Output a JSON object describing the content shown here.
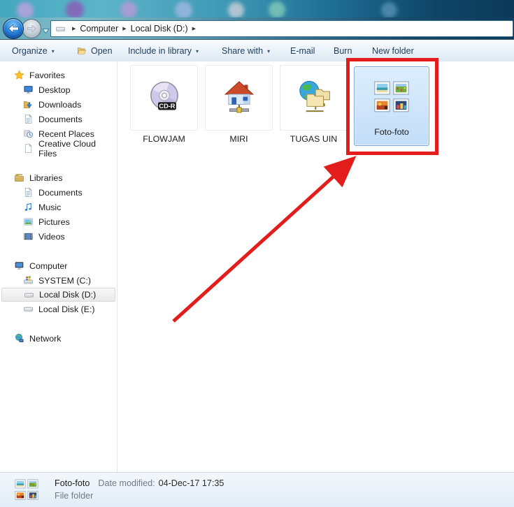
{
  "address_bar": {
    "breadcrumb": [
      "Computer",
      "Local Disk (D:)"
    ]
  },
  "toolbar": {
    "buttons": [
      {
        "label": "Organize",
        "dropdown": true
      },
      {
        "label": "Open",
        "icon": "open-folder-icon"
      },
      {
        "label": "Include in library",
        "dropdown": true
      },
      {
        "label": "Share with",
        "dropdown": true
      },
      {
        "label": "E-mail"
      },
      {
        "label": "Burn"
      },
      {
        "label": "New folder"
      }
    ]
  },
  "sidebar": {
    "sections": [
      {
        "label": "Favorites",
        "icon": "star-icon",
        "items": [
          {
            "label": "Desktop",
            "icon": "desktop-icon"
          },
          {
            "label": "Downloads",
            "icon": "downloads-icon"
          },
          {
            "label": "Documents",
            "icon": "document-icon"
          },
          {
            "label": "Recent Places",
            "icon": "recent-places-icon"
          },
          {
            "label": "Creative Cloud Files",
            "icon": "file-icon"
          }
        ]
      },
      {
        "label": "Libraries",
        "icon": "libraries-icon",
        "items": [
          {
            "label": "Documents",
            "icon": "document-icon"
          },
          {
            "label": "Music",
            "icon": "music-icon"
          },
          {
            "label": "Pictures",
            "icon": "pictures-icon"
          },
          {
            "label": "Videos",
            "icon": "videos-icon"
          }
        ]
      },
      {
        "label": "Computer",
        "icon": "computer-icon",
        "items": [
          {
            "label": "SYSTEM (C:)",
            "icon": "system-drive-icon"
          },
          {
            "label": "Local Disk (D:)",
            "icon": "drive-icon",
            "selected": true
          },
          {
            "label": "Local Disk (E:)",
            "icon": "drive-icon"
          }
        ]
      },
      {
        "label": "Network",
        "icon": "network-icon",
        "items": []
      }
    ]
  },
  "files": {
    "items": [
      {
        "label": "FLOWJAM",
        "icon": "cd-r-icon"
      },
      {
        "label": "MIRI",
        "icon": "network-home-icon"
      },
      {
        "label": "TUGAS UIN",
        "icon": "network-folders-icon"
      },
      {
        "label": "Foto-foto",
        "icon": "photos-folder-icon",
        "selected": true
      }
    ]
  },
  "details_pane": {
    "name": "Foto-foto",
    "date_label": "Date modified:",
    "date_value": "04-Dec-17 17:35",
    "type": "File folder",
    "icon": "photos-folder-icon"
  },
  "annotation": {
    "color": "#e31c1c",
    "target": "Foto-foto"
  },
  "colors": {
    "selection_border": "#7fa8d8",
    "selection_fill": "#c2ddf7",
    "toolbar_text": "#1e3c5c"
  }
}
